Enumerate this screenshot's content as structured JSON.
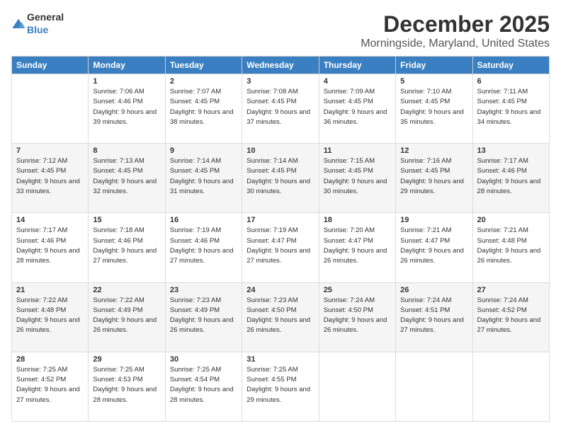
{
  "logo": {
    "general": "General",
    "blue": "Blue"
  },
  "header": {
    "month": "December 2025",
    "location": "Morningside, Maryland, United States"
  },
  "weekdays": [
    "Sunday",
    "Monday",
    "Tuesday",
    "Wednesday",
    "Thursday",
    "Friday",
    "Saturday"
  ],
  "weeks": [
    [
      {
        "day": "",
        "sunrise": "",
        "sunset": "",
        "daylight": ""
      },
      {
        "day": "1",
        "sunrise": "Sunrise: 7:06 AM",
        "sunset": "Sunset: 4:46 PM",
        "daylight": "Daylight: 9 hours and 39 minutes."
      },
      {
        "day": "2",
        "sunrise": "Sunrise: 7:07 AM",
        "sunset": "Sunset: 4:45 PM",
        "daylight": "Daylight: 9 hours and 38 minutes."
      },
      {
        "day": "3",
        "sunrise": "Sunrise: 7:08 AM",
        "sunset": "Sunset: 4:45 PM",
        "daylight": "Daylight: 9 hours and 37 minutes."
      },
      {
        "day": "4",
        "sunrise": "Sunrise: 7:09 AM",
        "sunset": "Sunset: 4:45 PM",
        "daylight": "Daylight: 9 hours and 36 minutes."
      },
      {
        "day": "5",
        "sunrise": "Sunrise: 7:10 AM",
        "sunset": "Sunset: 4:45 PM",
        "daylight": "Daylight: 9 hours and 35 minutes."
      },
      {
        "day": "6",
        "sunrise": "Sunrise: 7:11 AM",
        "sunset": "Sunset: 4:45 PM",
        "daylight": "Daylight: 9 hours and 34 minutes."
      }
    ],
    [
      {
        "day": "7",
        "sunrise": "Sunrise: 7:12 AM",
        "sunset": "Sunset: 4:45 PM",
        "daylight": "Daylight: 9 hours and 33 minutes."
      },
      {
        "day": "8",
        "sunrise": "Sunrise: 7:13 AM",
        "sunset": "Sunset: 4:45 PM",
        "daylight": "Daylight: 9 hours and 32 minutes."
      },
      {
        "day": "9",
        "sunrise": "Sunrise: 7:14 AM",
        "sunset": "Sunset: 4:45 PM",
        "daylight": "Daylight: 9 hours and 31 minutes."
      },
      {
        "day": "10",
        "sunrise": "Sunrise: 7:14 AM",
        "sunset": "Sunset: 4:45 PM",
        "daylight": "Daylight: 9 hours and 30 minutes."
      },
      {
        "day": "11",
        "sunrise": "Sunrise: 7:15 AM",
        "sunset": "Sunset: 4:45 PM",
        "daylight": "Daylight: 9 hours and 30 minutes."
      },
      {
        "day": "12",
        "sunrise": "Sunrise: 7:16 AM",
        "sunset": "Sunset: 4:45 PM",
        "daylight": "Daylight: 9 hours and 29 minutes."
      },
      {
        "day": "13",
        "sunrise": "Sunrise: 7:17 AM",
        "sunset": "Sunset: 4:46 PM",
        "daylight": "Daylight: 9 hours and 28 minutes."
      }
    ],
    [
      {
        "day": "14",
        "sunrise": "Sunrise: 7:17 AM",
        "sunset": "Sunset: 4:46 PM",
        "daylight": "Daylight: 9 hours and 28 minutes."
      },
      {
        "day": "15",
        "sunrise": "Sunrise: 7:18 AM",
        "sunset": "Sunset: 4:46 PM",
        "daylight": "Daylight: 9 hours and 27 minutes."
      },
      {
        "day": "16",
        "sunrise": "Sunrise: 7:19 AM",
        "sunset": "Sunset: 4:46 PM",
        "daylight": "Daylight: 9 hours and 27 minutes."
      },
      {
        "day": "17",
        "sunrise": "Sunrise: 7:19 AM",
        "sunset": "Sunset: 4:47 PM",
        "daylight": "Daylight: 9 hours and 27 minutes."
      },
      {
        "day": "18",
        "sunrise": "Sunrise: 7:20 AM",
        "sunset": "Sunset: 4:47 PM",
        "daylight": "Daylight: 9 hours and 26 minutes."
      },
      {
        "day": "19",
        "sunrise": "Sunrise: 7:21 AM",
        "sunset": "Sunset: 4:47 PM",
        "daylight": "Daylight: 9 hours and 26 minutes."
      },
      {
        "day": "20",
        "sunrise": "Sunrise: 7:21 AM",
        "sunset": "Sunset: 4:48 PM",
        "daylight": "Daylight: 9 hours and 26 minutes."
      }
    ],
    [
      {
        "day": "21",
        "sunrise": "Sunrise: 7:22 AM",
        "sunset": "Sunset: 4:48 PM",
        "daylight": "Daylight: 9 hours and 26 minutes."
      },
      {
        "day": "22",
        "sunrise": "Sunrise: 7:22 AM",
        "sunset": "Sunset: 4:49 PM",
        "daylight": "Daylight: 9 hours and 26 minutes."
      },
      {
        "day": "23",
        "sunrise": "Sunrise: 7:23 AM",
        "sunset": "Sunset: 4:49 PM",
        "daylight": "Daylight: 9 hours and 26 minutes."
      },
      {
        "day": "24",
        "sunrise": "Sunrise: 7:23 AM",
        "sunset": "Sunset: 4:50 PM",
        "daylight": "Daylight: 9 hours and 26 minutes."
      },
      {
        "day": "25",
        "sunrise": "Sunrise: 7:24 AM",
        "sunset": "Sunset: 4:50 PM",
        "daylight": "Daylight: 9 hours and 26 minutes."
      },
      {
        "day": "26",
        "sunrise": "Sunrise: 7:24 AM",
        "sunset": "Sunset: 4:51 PM",
        "daylight": "Daylight: 9 hours and 27 minutes."
      },
      {
        "day": "27",
        "sunrise": "Sunrise: 7:24 AM",
        "sunset": "Sunset: 4:52 PM",
        "daylight": "Daylight: 9 hours and 27 minutes."
      }
    ],
    [
      {
        "day": "28",
        "sunrise": "Sunrise: 7:25 AM",
        "sunset": "Sunset: 4:52 PM",
        "daylight": "Daylight: 9 hours and 27 minutes."
      },
      {
        "day": "29",
        "sunrise": "Sunrise: 7:25 AM",
        "sunset": "Sunset: 4:53 PM",
        "daylight": "Daylight: 9 hours and 28 minutes."
      },
      {
        "day": "30",
        "sunrise": "Sunrise: 7:25 AM",
        "sunset": "Sunset: 4:54 PM",
        "daylight": "Daylight: 9 hours and 28 minutes."
      },
      {
        "day": "31",
        "sunrise": "Sunrise: 7:25 AM",
        "sunset": "Sunset: 4:55 PM",
        "daylight": "Daylight: 9 hours and 29 minutes."
      },
      {
        "day": "",
        "sunrise": "",
        "sunset": "",
        "daylight": ""
      },
      {
        "day": "",
        "sunrise": "",
        "sunset": "",
        "daylight": ""
      },
      {
        "day": "",
        "sunrise": "",
        "sunset": "",
        "daylight": ""
      }
    ]
  ]
}
